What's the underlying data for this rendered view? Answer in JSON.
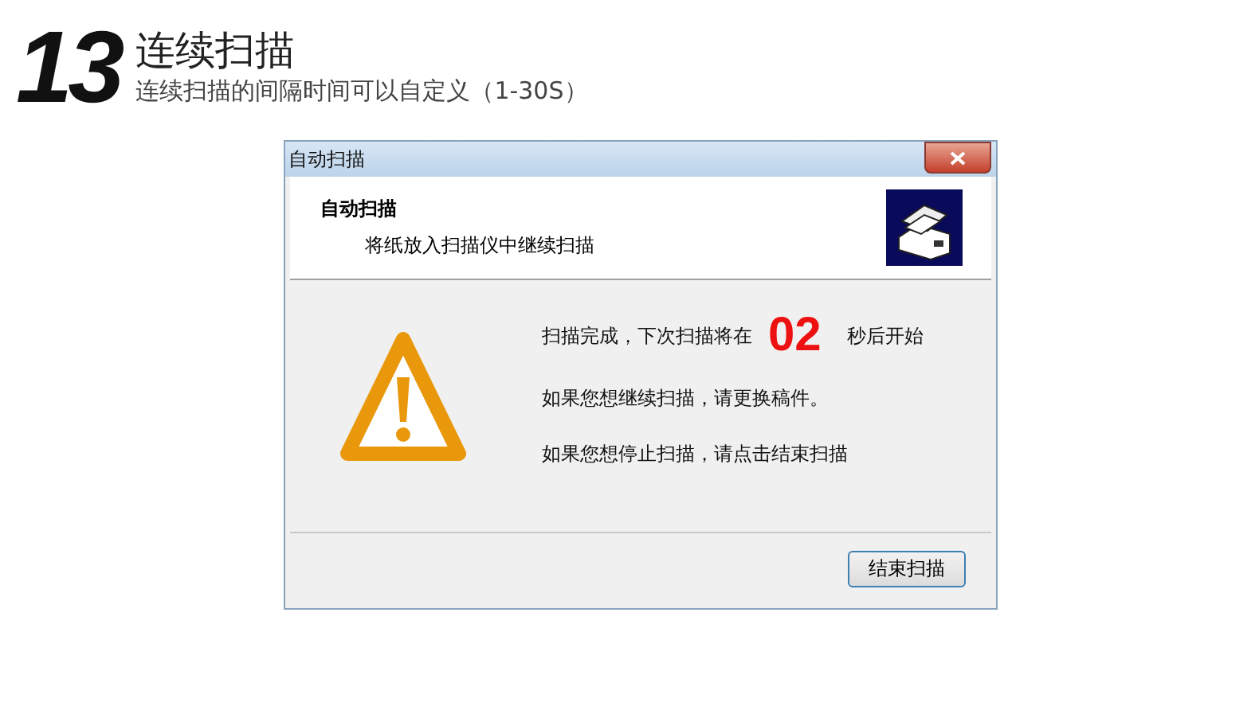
{
  "slide": {
    "number": "13",
    "title": "连续扫描",
    "subtitle": "连续扫描的间隔时间可以自定义（1-30S）"
  },
  "dialog": {
    "title": "自动扫描",
    "header": {
      "title": "自动扫描",
      "instruction": "将纸放入扫描仪中继续扫描"
    },
    "message": {
      "prefix": "扫描完成，下次扫描将在",
      "countdown": "02",
      "suffix": "秒后开始",
      "lines": [
        "如果您想继续扫描，请更换稿件。",
        "如果您想停止扫描，请点击结束扫描"
      ]
    },
    "buttons": [
      "结束扫描"
    ]
  }
}
